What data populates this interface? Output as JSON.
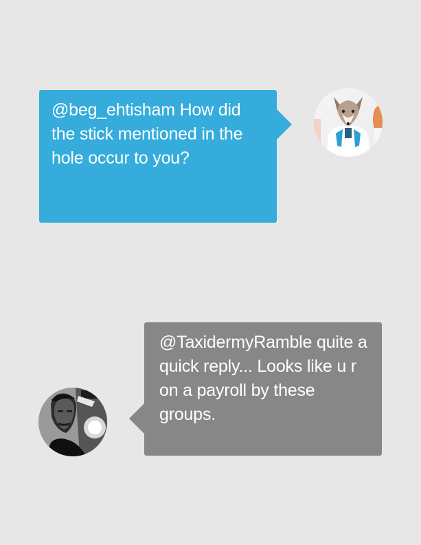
{
  "colors": {
    "background": "#e6e7e6",
    "incoming_bubble": "#35acdb",
    "outgoing_bubble": "#878787",
    "text": "#ffffff"
  },
  "messages": [
    {
      "text": "@beg_ehtisham How did the stick mentioned in the hole occur to you?",
      "avatar_icon": "fox-scientist-avatar-icon"
    },
    {
      "text": "@TaxidermyRamble quite a quick reply... Looks like u r on a payroll by these groups.",
      "avatar_icon": "man-portrait-avatar-icon"
    }
  ]
}
